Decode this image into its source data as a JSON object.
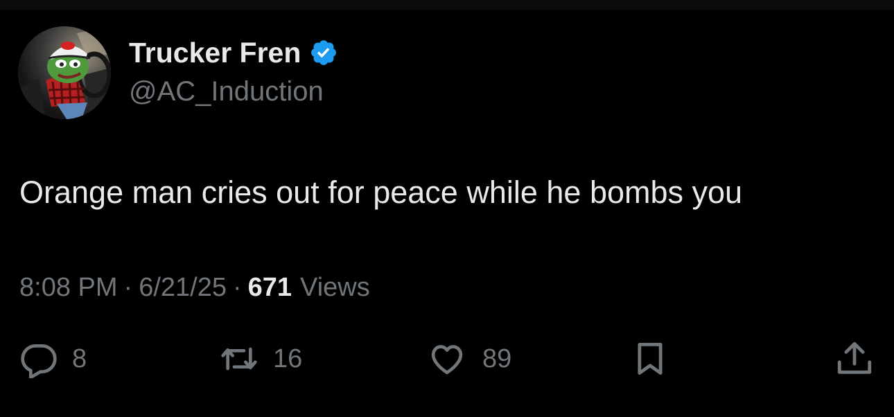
{
  "author": {
    "display_name": "Trucker Fren",
    "handle": "@AC_Induction",
    "verified": true,
    "verified_color": "#1d9bf0"
  },
  "tweet": {
    "text": "Orange man cries out for peace while he bombs you",
    "time": "8:08 PM",
    "date": "6/21/25",
    "separator": "·",
    "views_count": "671",
    "views_label": "Views"
  },
  "actions": {
    "reply_count": "8",
    "repost_count": "16",
    "like_count": "89"
  },
  "icons": [
    "reply-icon",
    "repost-icon",
    "like-icon",
    "bookmark-icon",
    "share-icon",
    "verified-badge-icon"
  ],
  "colors": {
    "background": "#000000",
    "text_primary": "#e7e9ea",
    "text_secondary": "#71767b"
  }
}
